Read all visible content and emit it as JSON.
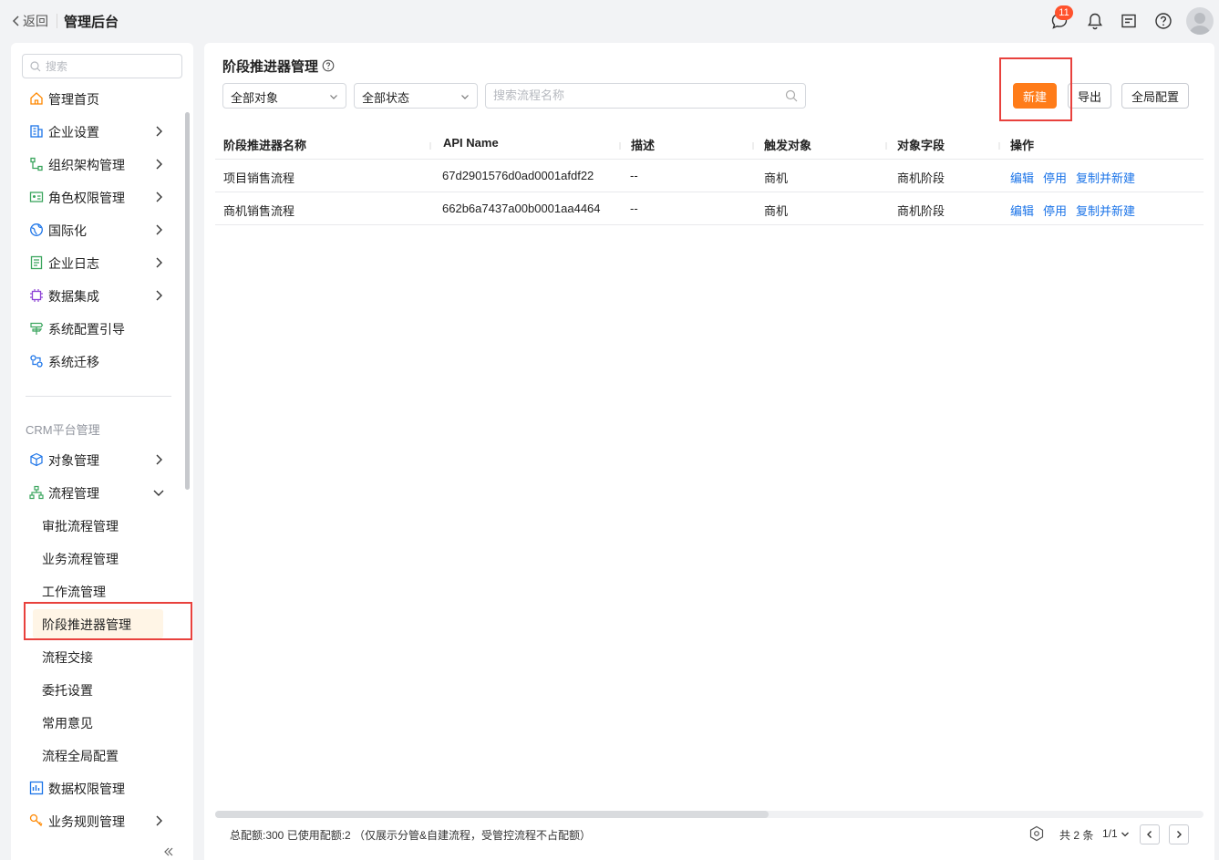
{
  "header": {
    "back_label": "返回",
    "title": "管理后台",
    "message_badge": "11",
    "icons": [
      "chat-icon",
      "bell-icon",
      "inbox-icon",
      "help-icon",
      "avatar"
    ]
  },
  "sidebar": {
    "search_placeholder": "搜索",
    "items": [
      {
        "label": "管理首页",
        "icon": "home-icon",
        "arrow": false
      },
      {
        "label": "企业设置",
        "icon": "enterprise-icon",
        "arrow": true
      },
      {
        "label": "组织架构管理",
        "icon": "org-icon",
        "arrow": true
      },
      {
        "label": "角色权限管理",
        "icon": "id-card-icon",
        "arrow": true
      },
      {
        "label": "国际化",
        "icon": "globe-icon",
        "arrow": true
      },
      {
        "label": "企业日志",
        "icon": "log-icon",
        "arrow": true
      },
      {
        "label": "数据集成",
        "icon": "chip-icon",
        "arrow": true
      },
      {
        "label": "系统配置引导",
        "icon": "signpost-icon",
        "arrow": false
      },
      {
        "label": "系统迁移",
        "icon": "migrate-icon",
        "arrow": false
      }
    ],
    "group_label": "CRM平台管理",
    "crm_items": [
      {
        "label": "对象管理",
        "icon": "cube-icon",
        "arrow": true
      },
      {
        "label": "流程管理",
        "icon": "flow-icon",
        "arrow": true,
        "expanded": true
      }
    ],
    "sub_items": [
      "审批流程管理",
      "业务流程管理",
      "工作流管理",
      "阶段推进器管理",
      "流程交接",
      "委托设置",
      "常用意见",
      "流程全局配置"
    ],
    "active_sub_item": "阶段推进器管理",
    "bottom_items": [
      {
        "label": "数据权限管理",
        "icon": "data-permission-icon",
        "arrow": false
      },
      {
        "label": "业务规则管理",
        "icon": "rule-icon",
        "arrow": true
      }
    ]
  },
  "main": {
    "title": "阶段推进器管理",
    "filters": {
      "object_select": "全部对象",
      "status_select": "全部状态",
      "search_placeholder": "搜索流程名称"
    },
    "buttons": {
      "new": "新建",
      "export": "导出",
      "global_config": "全局配置"
    },
    "table": {
      "columns": [
        "阶段推进器名称",
        "API Name",
        "描述",
        "触发对象",
        "对象字段",
        "操作"
      ],
      "rows": [
        {
          "name": "项目销售流程",
          "api_name": "67d2901576d0ad0001afdf22",
          "desc": "--",
          "trigger_object": "商机",
          "object_field": "商机阶段"
        },
        {
          "name": "商机销售流程",
          "api_name": "662b6a7437a00b0001aa4464",
          "desc": "--",
          "trigger_object": "商机",
          "object_field": "商机阶段"
        }
      ],
      "actions": [
        "编辑",
        "停用",
        "复制并新建"
      ]
    },
    "footer": {
      "quota_note": "总配额:300 已使用配额:2 （仅展示分管&自建流程，受管控流程不占配额）",
      "total": "共 2 条",
      "page": "1/1"
    }
  },
  "colors": {
    "accent": "#ff7c19",
    "link": "#1a73e8",
    "highlight_box": "#e8413d",
    "badge": "#ff522d",
    "active_bg": "#fff5e6"
  }
}
